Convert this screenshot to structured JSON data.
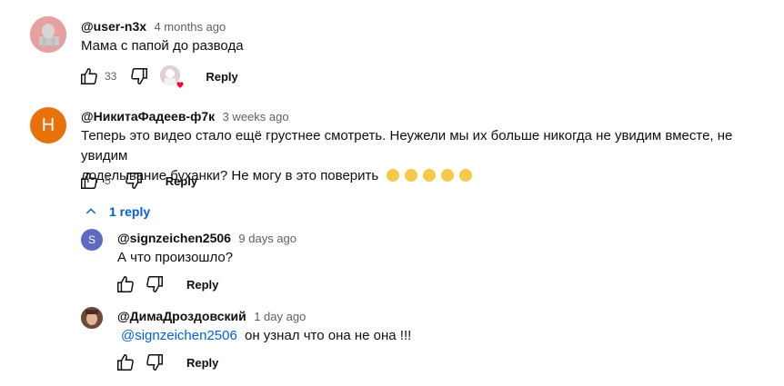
{
  "comments": [
    {
      "author": "@user-n3x",
      "time": "4 months ago",
      "text": "Мама с папой до развода",
      "likes": "33",
      "reply_label": "Reply"
    },
    {
      "author": "@НикитаФадеев-ф7к",
      "avatar_letter": "H",
      "avatar_color": "#e8710a",
      "time": "3 weeks ago",
      "text_line1": "Теперь это видео стало ещё грустнее смотреть. Неужели мы их больше никогда не увидим вместе, не увидим",
      "text_line2": "доделывание буханки? Не могу в это поверить",
      "likes": "5",
      "reply_label": "Reply",
      "replies_toggle": "1 reply"
    }
  ],
  "replies": [
    {
      "author": "@signzeichen2506",
      "avatar_letter": "S",
      "avatar_color": "#5c6bc0",
      "time": "9 days ago",
      "text": "А что произошло?",
      "reply_label": "Reply"
    },
    {
      "author": "@ДимаДроздовский",
      "time": "1 day ago",
      "mention": "@signzeichen2506",
      "text": "он узнал что она не она !!!",
      "reply_label": "Reply"
    }
  ],
  "icons": {
    "like": "thumbs-up-icon",
    "dislike": "thumbs-down-icon",
    "heart": "creator-heart-icon",
    "chevron": "chevron-up-icon"
  }
}
